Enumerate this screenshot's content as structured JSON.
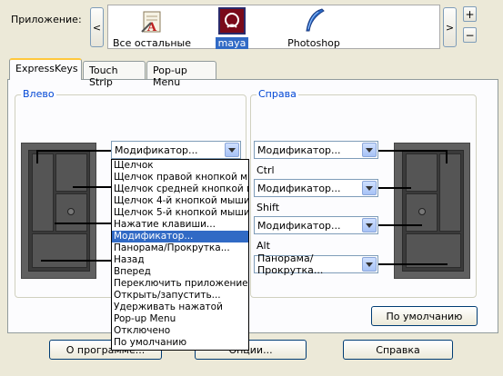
{
  "app_row": {
    "label": "Приложение:",
    "prev_label": "<",
    "next_label": ">",
    "add_label": "+",
    "remove_label": "−",
    "apps": [
      {
        "label": "Все остальные",
        "icon": "all-apps-icon"
      },
      {
        "label": "maya",
        "icon": "maya-icon"
      },
      {
        "label": "Photoshop",
        "icon": "photoshop-icon"
      }
    ]
  },
  "tabs": [
    {
      "label": "ExpressKeys"
    },
    {
      "label": "Touch Strip"
    },
    {
      "label": "Pop-up Menu"
    }
  ],
  "left_group": {
    "title": "Влево",
    "top_combo": "Модификатор..."
  },
  "right_group": {
    "title": "Справа",
    "combos": [
      "Модификатор...",
      "Модификатор...",
      "Модификатор...",
      "Панорама/Прокрутка..."
    ],
    "modifiers": [
      "Ctrl",
      "Shift",
      "Alt"
    ]
  },
  "dropdown": {
    "items": [
      "Щелчок",
      "Щелчок правой кнопкой мыши",
      "Щелчок средней кнопкой мыши",
      "Щелчок 4-й кнопкой мыши",
      "Щелчок 5-й кнопкой мыши",
      "Нажатие клавиши...",
      "Модификатор...",
      "Панорама/Прокрутка...",
      "Назад",
      "Вперед",
      "Переключить приложение",
      "Открыть/запустить...",
      "Удерживать нажатой",
      "Pop-up Menu",
      "Отключено",
      "По умолчанию"
    ],
    "selected": "Модификатор..."
  },
  "default_button": "По умолчанию",
  "bottom_buttons": [
    "О программе...",
    "Опции...",
    "Справка"
  ]
}
